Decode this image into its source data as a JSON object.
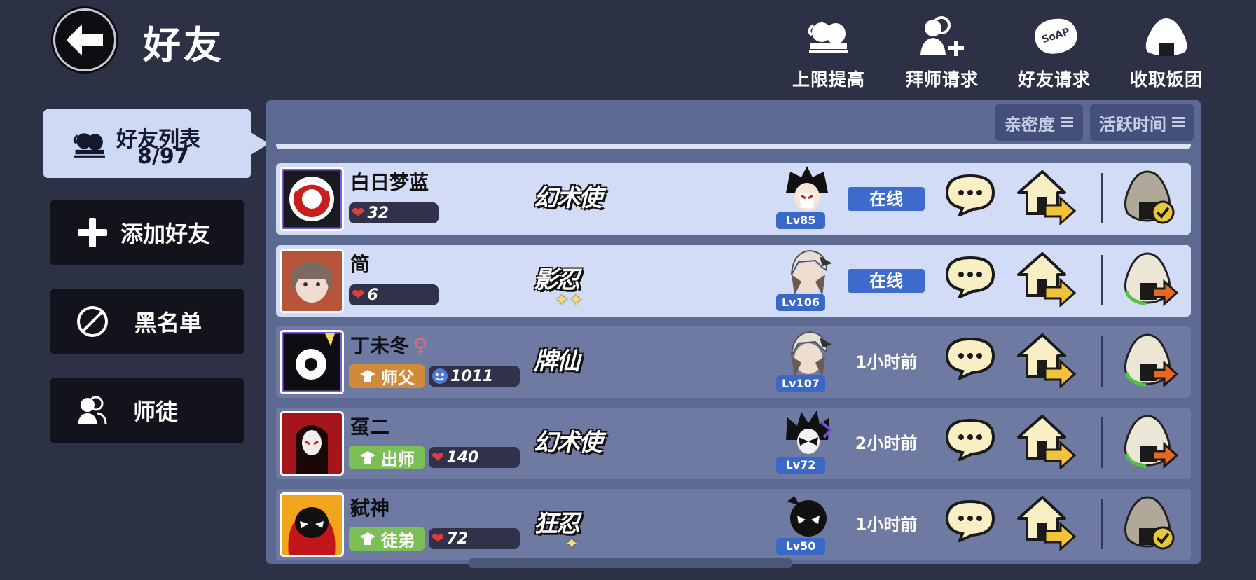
{
  "header": {
    "title": "好友",
    "buttons": [
      {
        "label": "上限提高",
        "icon": "two-heads-icon"
      },
      {
        "label": "拜师请求",
        "icon": "person-plus-icon"
      },
      {
        "label": "好友请求",
        "icon": "soap-bubble-icon"
      },
      {
        "label": "收取饭团",
        "icon": "rice-ball-icon"
      }
    ],
    "soap_text": "SoAP"
  },
  "sidebar": {
    "active_tab": {
      "label": "好友列表",
      "count": "8/97"
    },
    "items": [
      {
        "label": "添加好友",
        "icon": "plus-icon"
      },
      {
        "label": "黑名单",
        "icon": "ban-icon"
      },
      {
        "label": "师徒",
        "icon": "master-apprentice-icon"
      }
    ]
  },
  "sort": {
    "intimacy": "亲密度",
    "active_time": "活跃时间"
  },
  "friends": [
    {
      "name": "白日梦蓝",
      "gender": "",
      "role": "",
      "stat_icon": "heart",
      "stat": "32",
      "class_name": "幻术使",
      "stars": "",
      "level": "Lv85",
      "status": "在线",
      "online": true,
      "gift_state": "collected"
    },
    {
      "name": "简",
      "gender": "",
      "role": "",
      "stat_icon": "heart",
      "stat": "6",
      "class_name": "影忍",
      "stars": "✦✦",
      "level": "Lv106",
      "status": "在线",
      "online": true,
      "gift_state": "send"
    },
    {
      "name": "丁未冬",
      "gender": "♀",
      "role": "师父",
      "stat_icon": "face",
      "stat": "1011",
      "class_name": "牌仙",
      "stars": "",
      "level": "Lv107",
      "status": "1小时前",
      "online": false,
      "gift_state": "send"
    },
    {
      "name": "虿二",
      "gender": "",
      "role": "出师",
      "stat_icon": "heart",
      "stat": "140",
      "class_name": "幻术使",
      "stars": "",
      "level": "Lv72",
      "status": "2小时前",
      "online": false,
      "gift_state": "send"
    },
    {
      "name": "弑神",
      "gender": "",
      "role": "徒弟",
      "stat_icon": "heart",
      "stat": "72",
      "class_name": "狂忍",
      "stars": "✦",
      "level": "Lv50",
      "status": "1小时前",
      "online": false,
      "gift_state": "collected"
    }
  ],
  "colors": {
    "background": "#2d3146",
    "panel": "#5c6991",
    "row_online": "#d2dcf6",
    "row_offline": "#6e7aa1",
    "online_badge": "#3d6ccd",
    "role_master": "#d08a3a",
    "role_graduate": "#7cbf57",
    "role_apprentice": "#7cbf57",
    "heart": "#e23b3b"
  }
}
